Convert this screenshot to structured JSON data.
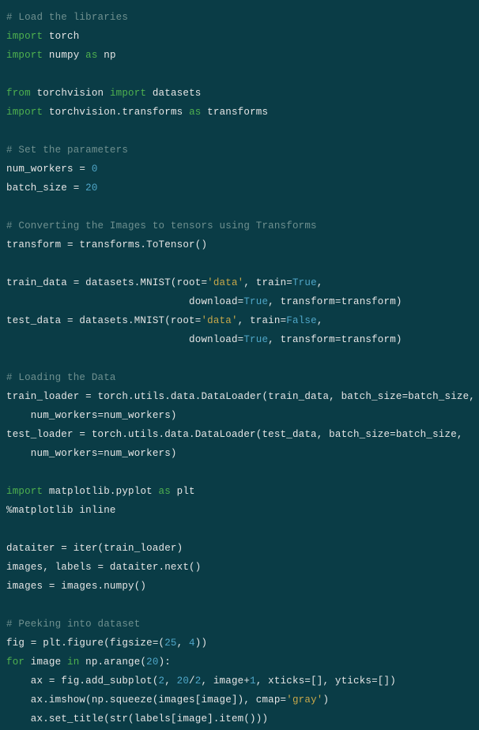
{
  "code": {
    "lines": [
      {
        "segs": [
          {
            "cls": "c",
            "t": "# Load the libraries"
          }
        ]
      },
      {
        "segs": [
          {
            "cls": "kw",
            "t": "import"
          },
          {
            "cls": "fn",
            "t": " torch"
          }
        ]
      },
      {
        "segs": [
          {
            "cls": "kw",
            "t": "import"
          },
          {
            "cls": "fn",
            "t": " numpy "
          },
          {
            "cls": "kw",
            "t": "as"
          },
          {
            "cls": "fn",
            "t": " np"
          }
        ]
      },
      {
        "segs": [
          {
            "cls": "fn",
            "t": ""
          }
        ]
      },
      {
        "segs": [
          {
            "cls": "kw",
            "t": "from"
          },
          {
            "cls": "fn",
            "t": " torchvision "
          },
          {
            "cls": "kw",
            "t": "import"
          },
          {
            "cls": "fn",
            "t": " datasets"
          }
        ]
      },
      {
        "segs": [
          {
            "cls": "kw",
            "t": "import"
          },
          {
            "cls": "fn",
            "t": " torchvision.transforms "
          },
          {
            "cls": "kw",
            "t": "as"
          },
          {
            "cls": "fn",
            "t": " transforms"
          }
        ]
      },
      {
        "segs": [
          {
            "cls": "fn",
            "t": ""
          }
        ]
      },
      {
        "segs": [
          {
            "cls": "c",
            "t": "# Set the parameters"
          }
        ]
      },
      {
        "segs": [
          {
            "cls": "fn",
            "t": "num_workers = "
          },
          {
            "cls": "n",
            "t": "0"
          }
        ]
      },
      {
        "segs": [
          {
            "cls": "fn",
            "t": "batch_size = "
          },
          {
            "cls": "n",
            "t": "20"
          }
        ]
      },
      {
        "segs": [
          {
            "cls": "fn",
            "t": ""
          }
        ]
      },
      {
        "segs": [
          {
            "cls": "c",
            "t": "# Converting the Images to tensors using Transforms"
          }
        ]
      },
      {
        "segs": [
          {
            "cls": "fn",
            "t": "transform = transforms.ToTensor()"
          }
        ]
      },
      {
        "segs": [
          {
            "cls": "fn",
            "t": ""
          }
        ]
      },
      {
        "segs": [
          {
            "cls": "fn",
            "t": "train_data = datasets.MNIST(root="
          },
          {
            "cls": "s",
            "t": "'data'"
          },
          {
            "cls": "fn",
            "t": ", train="
          },
          {
            "cls": "b",
            "t": "True"
          },
          {
            "cls": "fn",
            "t": ","
          }
        ]
      },
      {
        "segs": [
          {
            "cls": "fn",
            "t": "                              download="
          },
          {
            "cls": "b",
            "t": "True"
          },
          {
            "cls": "fn",
            "t": ", transform=transform)"
          }
        ]
      },
      {
        "segs": [
          {
            "cls": "fn",
            "t": "test_data = datasets.MNIST(root="
          },
          {
            "cls": "s",
            "t": "'data'"
          },
          {
            "cls": "fn",
            "t": ", train="
          },
          {
            "cls": "b",
            "t": "False"
          },
          {
            "cls": "fn",
            "t": ","
          }
        ]
      },
      {
        "segs": [
          {
            "cls": "fn",
            "t": "                              download="
          },
          {
            "cls": "b",
            "t": "True"
          },
          {
            "cls": "fn",
            "t": ", transform=transform)"
          }
        ]
      },
      {
        "segs": [
          {
            "cls": "fn",
            "t": ""
          }
        ]
      },
      {
        "segs": [
          {
            "cls": "c",
            "t": "# Loading the Data"
          }
        ]
      },
      {
        "segs": [
          {
            "cls": "fn",
            "t": "train_loader = torch.utils.data.DataLoader(train_data, batch_size=batch_size,"
          }
        ]
      },
      {
        "segs": [
          {
            "cls": "fn",
            "t": "    num_workers=num_workers)"
          }
        ]
      },
      {
        "segs": [
          {
            "cls": "fn",
            "t": "test_loader = torch.utils.data.DataLoader(test_data, batch_size=batch_size,"
          }
        ]
      },
      {
        "segs": [
          {
            "cls": "fn",
            "t": "    num_workers=num_workers)"
          }
        ]
      },
      {
        "segs": [
          {
            "cls": "fn",
            "t": ""
          }
        ]
      },
      {
        "segs": [
          {
            "cls": "kw",
            "t": "import"
          },
          {
            "cls": "fn",
            "t": " matplotlib.pyplot "
          },
          {
            "cls": "kw",
            "t": "as"
          },
          {
            "cls": "fn",
            "t": " plt"
          }
        ]
      },
      {
        "segs": [
          {
            "cls": "m",
            "t": "%matplotlib inline"
          }
        ]
      },
      {
        "segs": [
          {
            "cls": "fn",
            "t": ""
          }
        ]
      },
      {
        "segs": [
          {
            "cls": "fn",
            "t": "dataiter = iter(train_loader)"
          }
        ]
      },
      {
        "segs": [
          {
            "cls": "fn",
            "t": "images, labels = dataiter.next()"
          }
        ]
      },
      {
        "segs": [
          {
            "cls": "fn",
            "t": "images = images.numpy()"
          }
        ]
      },
      {
        "segs": [
          {
            "cls": "fn",
            "t": ""
          }
        ]
      },
      {
        "segs": [
          {
            "cls": "c",
            "t": "# Peeking into dataset"
          }
        ]
      },
      {
        "segs": [
          {
            "cls": "fn",
            "t": "fig = plt.figure(figsize=("
          },
          {
            "cls": "n",
            "t": "25"
          },
          {
            "cls": "fn",
            "t": ", "
          },
          {
            "cls": "n",
            "t": "4"
          },
          {
            "cls": "fn",
            "t": "))"
          }
        ]
      },
      {
        "segs": [
          {
            "cls": "kw",
            "t": "for"
          },
          {
            "cls": "fn",
            "t": " image "
          },
          {
            "cls": "kw",
            "t": "in"
          },
          {
            "cls": "fn",
            "t": " np.arange("
          },
          {
            "cls": "n",
            "t": "20"
          },
          {
            "cls": "fn",
            "t": "):"
          }
        ]
      },
      {
        "segs": [
          {
            "cls": "fn",
            "t": "    ax = fig.add_subplot("
          },
          {
            "cls": "n",
            "t": "2"
          },
          {
            "cls": "fn",
            "t": ", "
          },
          {
            "cls": "n",
            "t": "20"
          },
          {
            "cls": "fn",
            "t": "/"
          },
          {
            "cls": "n",
            "t": "2"
          },
          {
            "cls": "fn",
            "t": ", image+"
          },
          {
            "cls": "n",
            "t": "1"
          },
          {
            "cls": "fn",
            "t": ", xticks=[], yticks=[])"
          }
        ]
      },
      {
        "segs": [
          {
            "cls": "fn",
            "t": "    ax.imshow(np.squeeze(images[image]), cmap="
          },
          {
            "cls": "s",
            "t": "'gray'"
          },
          {
            "cls": "fn",
            "t": ")"
          }
        ]
      },
      {
        "segs": [
          {
            "cls": "fn",
            "t": "    ax.set_title(str(labels[image].item()))"
          }
        ]
      }
    ]
  }
}
